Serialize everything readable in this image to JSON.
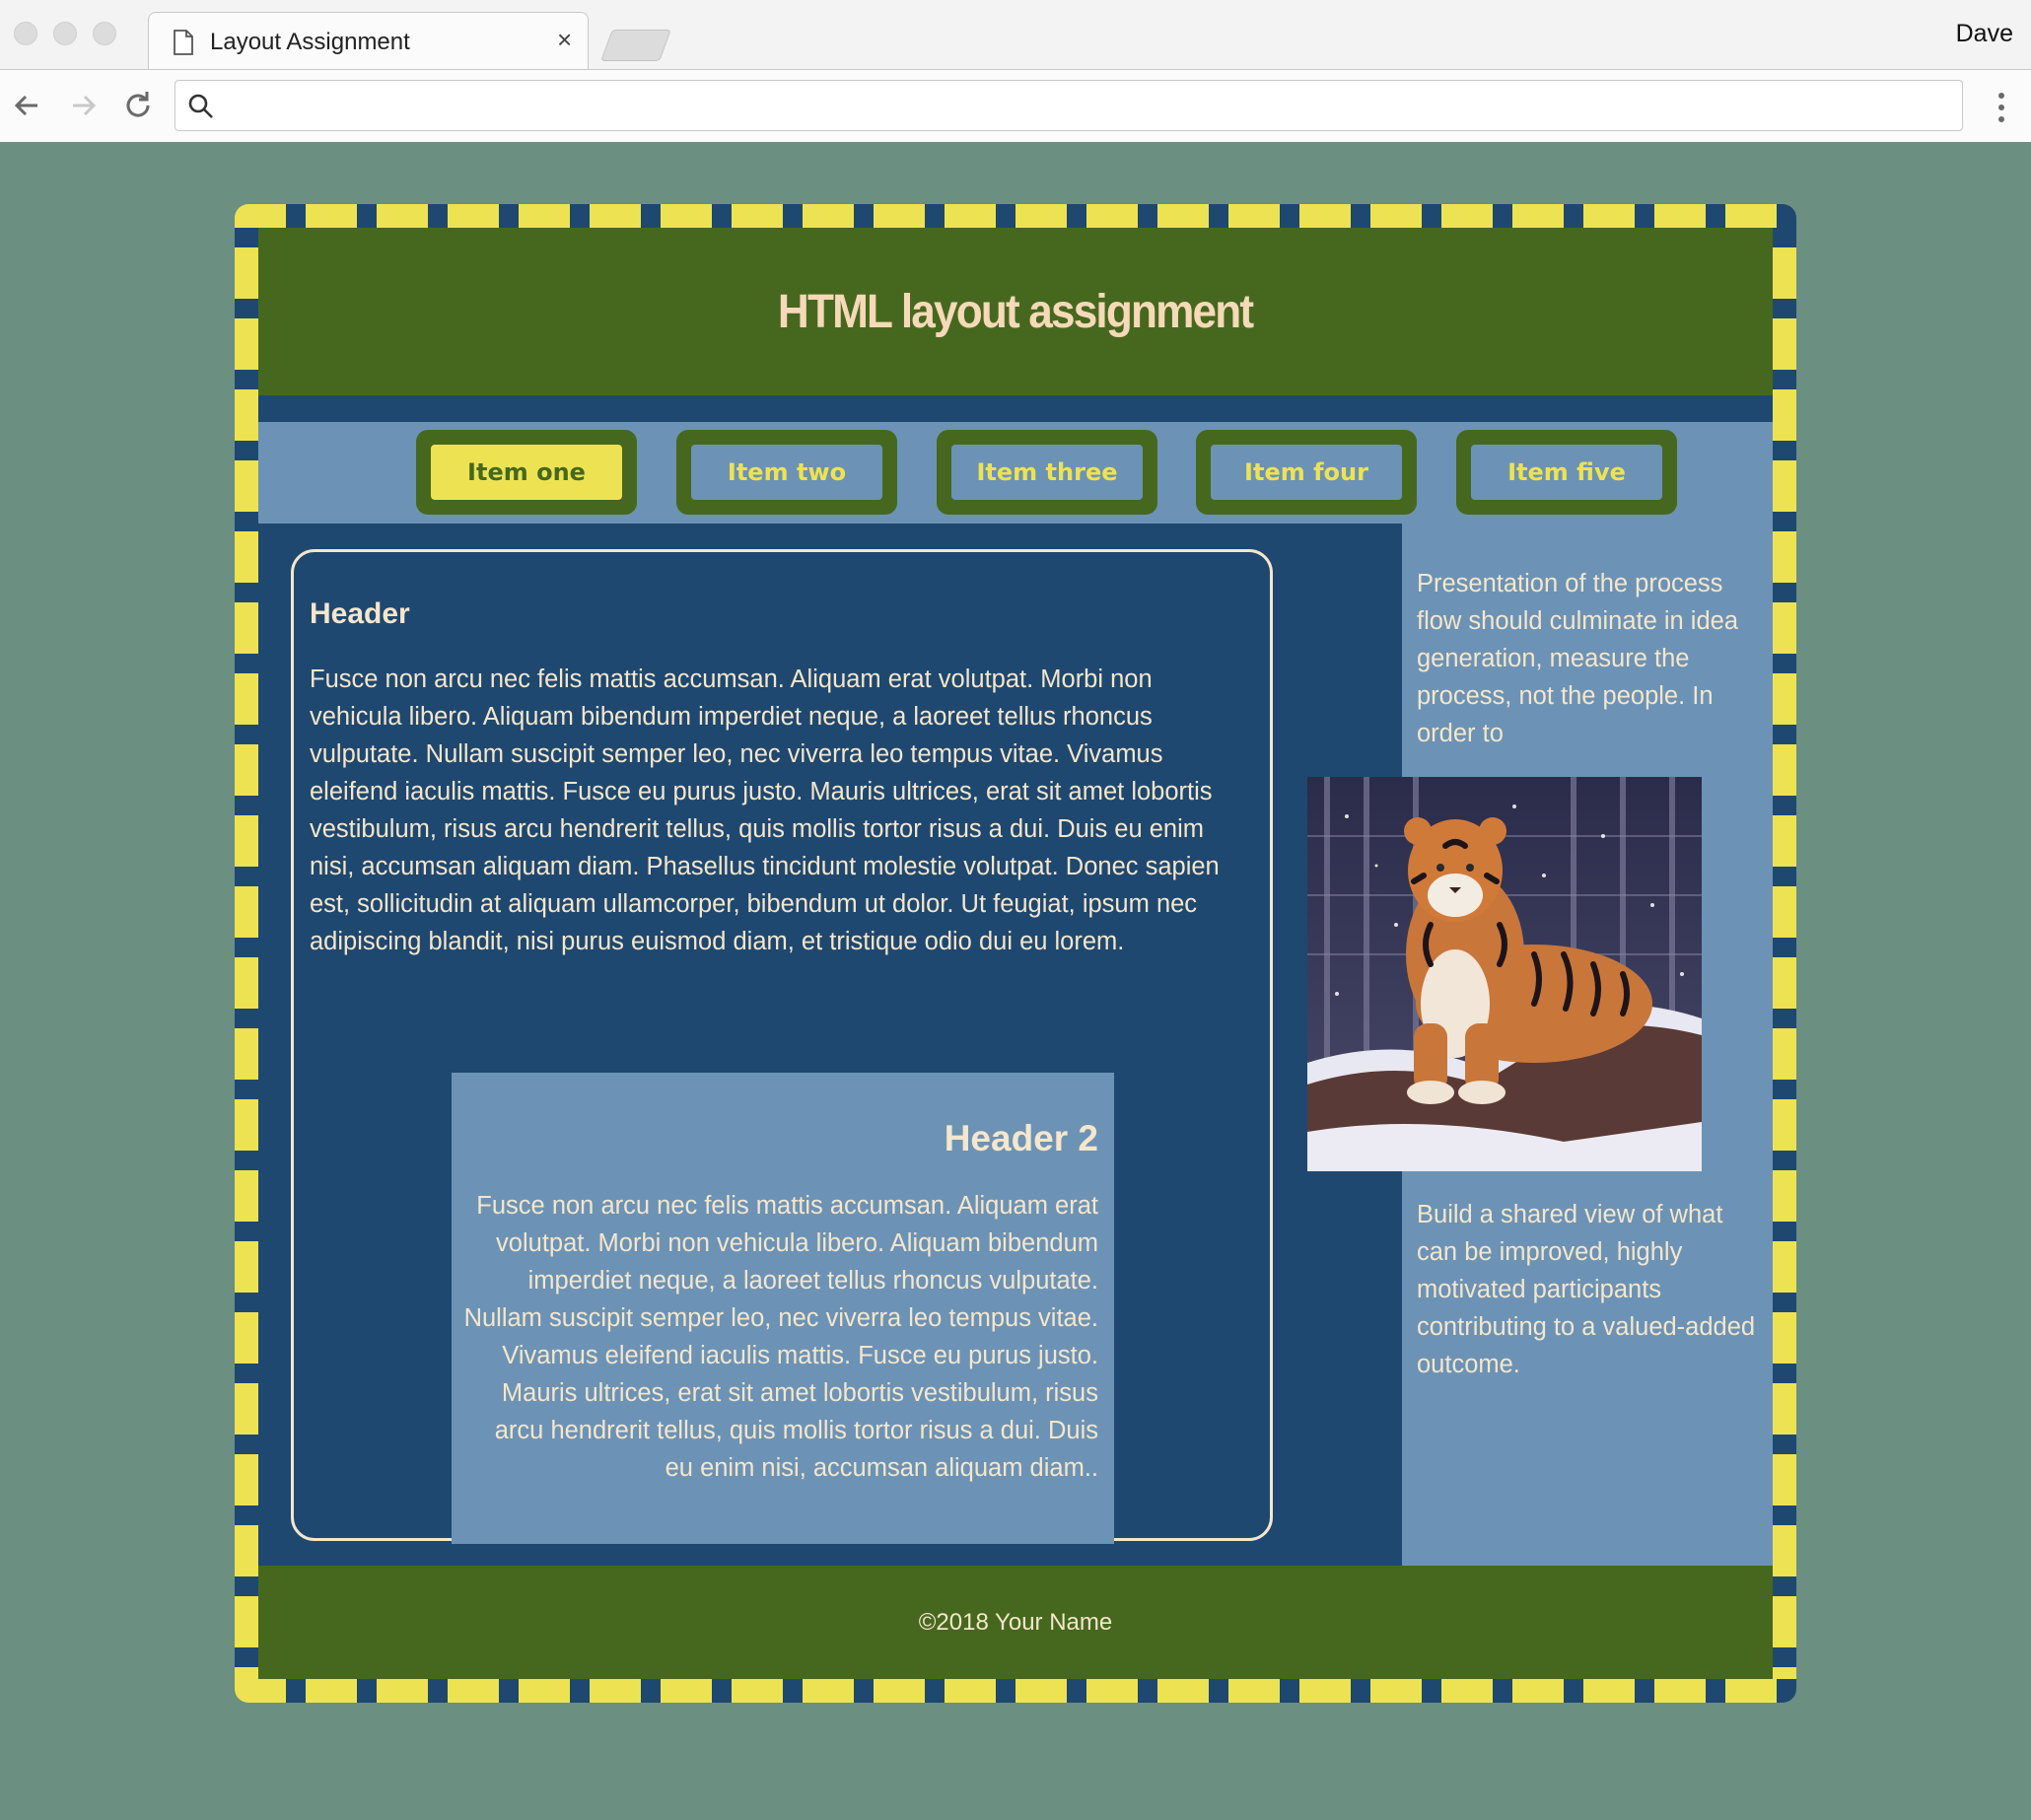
{
  "browser": {
    "tab_title": "Layout Assignment",
    "tab_close": "×",
    "user": "Dave",
    "address_value": "",
    "icons": [
      "document-icon",
      "back-arrow-icon",
      "forward-arrow-icon",
      "reload-icon",
      "search-icon",
      "more-menu-icon"
    ]
  },
  "page": {
    "title": "HTML layout assignment",
    "nav": [
      {
        "label": "Item one",
        "active": true
      },
      {
        "label": "Item two",
        "active": false
      },
      {
        "label": "Item three",
        "active": false
      },
      {
        "label": "Item four",
        "active": false
      },
      {
        "label": "Item five",
        "active": false
      }
    ],
    "main": {
      "header": "Header",
      "body": "Fusce non arcu nec felis mattis accumsan. Aliquam erat volutpat. Morbi non vehicula libero. Aliquam bibendum imperdiet neque, a laoreet tellus rhoncus vulputate. Nullam suscipit semper leo, nec viverra leo tempus vitae. Vivamus eleifend iaculis mattis. Fusce eu purus justo. Mauris ultrices, erat sit amet lobortis vestibulum, risus arcu hendrerit tellus, quis mollis tortor risus a dui. Duis eu enim nisi, accumsan aliquam diam. Phasellus tincidunt molestie volutpat. Donec sapien est, sollicitudin at aliquam ullamcorper, bibendum ut dolor. Ut feugiat, ipsum nec adipiscing blandit, nisi purus euismod diam, et tristique odio dui eu lorem."
    },
    "section2": {
      "header": "Header 2",
      "body": "Fusce non arcu nec felis mattis accumsan. Aliquam erat volutpat. Morbi non vehicula libero. Aliquam bibendum imperdiet neque, a laoreet tellus rhoncus vulputate. Nullam suscipit semper leo, nec viverra leo tempus vitae. Vivamus eleifend iaculis mattis. Fusce eu purus justo. Mauris ultrices, erat sit amet lobortis vestibulum, risus arcu hendrerit tellus, quis mollis tortor risus a dui. Duis eu enim nisi, accumsan aliquam diam.."
    },
    "aside": {
      "p1": "Presentation of the process flow should culminate in idea generation, measure the process, not the people. In order to",
      "p2": "Build a shared view of what can be improved, highly motivated participants contributing to a valued-added outcome.",
      "image": "tiger-photo"
    },
    "footer": "©2018 Your Name",
    "colors": {
      "background": "#6b8f80",
      "header_green": "#46681e",
      "navy": "#1e4870",
      "steel_blue": "#6c93b5",
      "yellow": "#ede352",
      "cream": "#f5e6cc"
    }
  }
}
